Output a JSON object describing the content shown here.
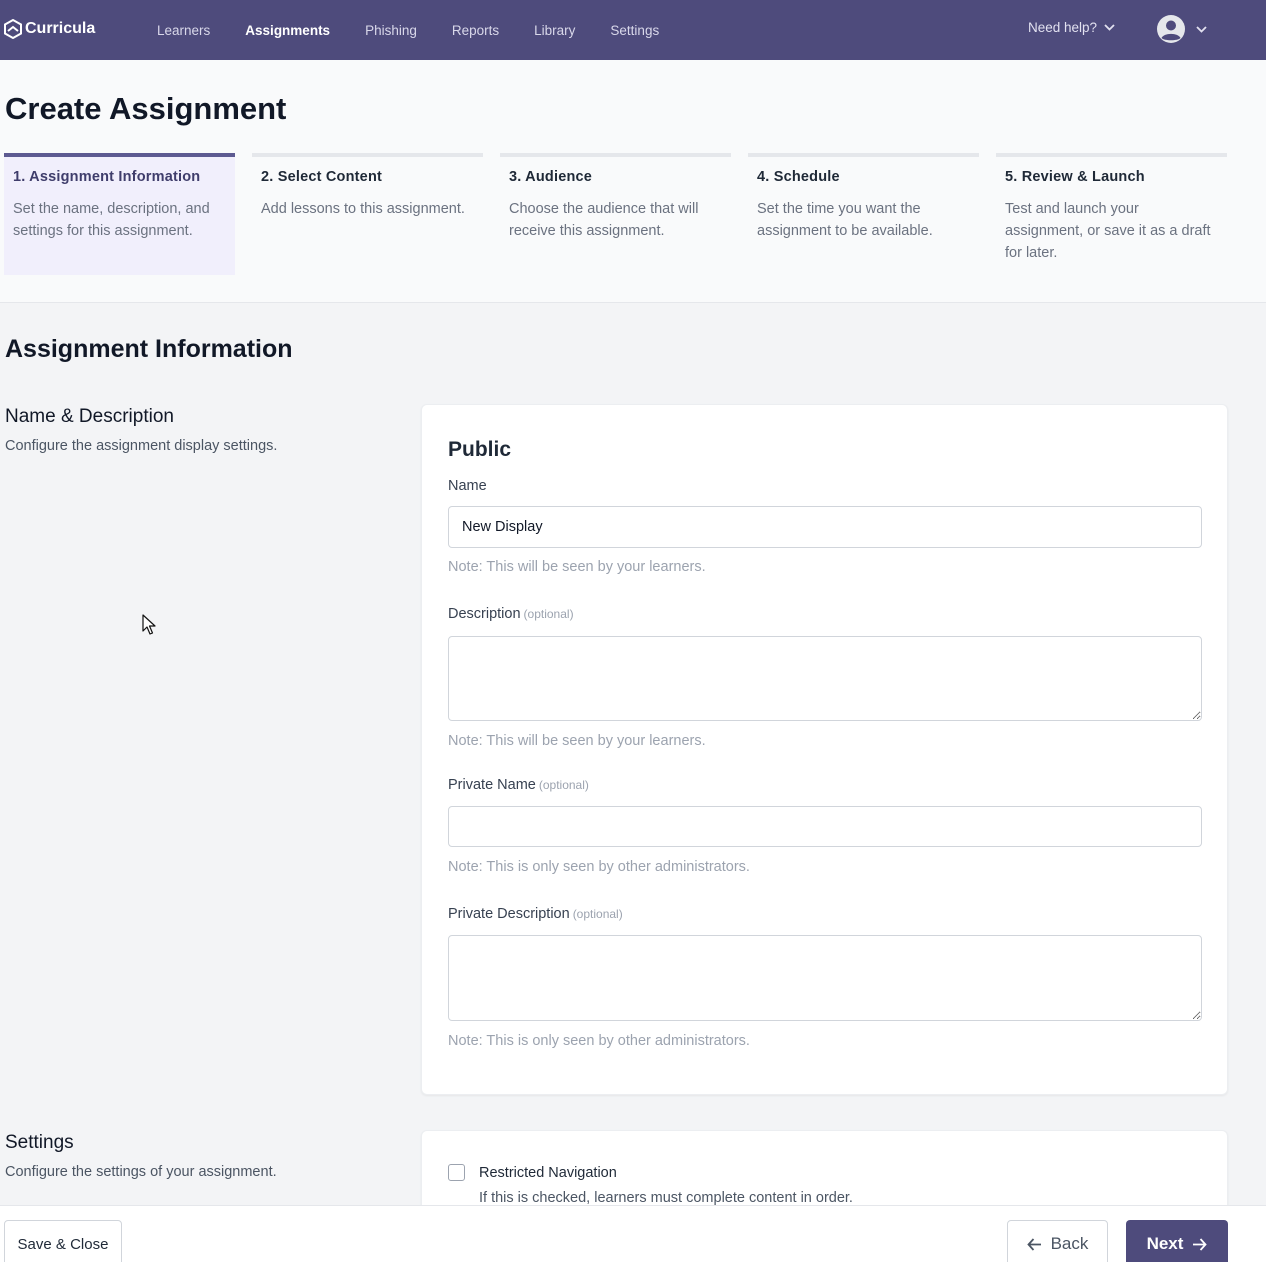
{
  "nav": {
    "brand": "Curricula",
    "links": [
      "Learners",
      "Assignments",
      "Phishing",
      "Reports",
      "Library",
      "Settings"
    ],
    "active": "Assignments",
    "help": "Need help?"
  },
  "page": {
    "title": "Create Assignment"
  },
  "steps": [
    {
      "title": "1. Assignment Information",
      "desc": "Set the name, description, and settings for this assignment."
    },
    {
      "title": "2. Select Content",
      "desc": "Add lessons to this assignment."
    },
    {
      "title": "3. Audience",
      "desc": "Choose the audience that will receive this assignment."
    },
    {
      "title": "4. Schedule",
      "desc": "Set the time you want the assignment to be available."
    },
    {
      "title": "5. Review & Launch",
      "desc": "Test and launch your assignment, or save it as a draft for later."
    }
  ],
  "section": {
    "heading": "Assignment Information",
    "name_desc": {
      "title": "Name & Description",
      "desc": "Configure the assignment display settings."
    },
    "settings": {
      "title": "Settings",
      "desc": "Configure the settings of your assignment."
    }
  },
  "form": {
    "card_title": "Public",
    "name": {
      "label": "Name",
      "value": "New Display",
      "note": "Note: This will be seen by your learners."
    },
    "description": {
      "label": "Description",
      "optional": "(optional)",
      "value": "",
      "note": "Note: This will be seen by your learners."
    },
    "private_name": {
      "label": "Private Name",
      "optional": "(optional)",
      "value": "",
      "note": "Note: This is only seen by other administrators."
    },
    "private_description": {
      "label": "Private Description",
      "optional": "(optional)",
      "value": "",
      "note": "Note: This is only seen by other administrators."
    }
  },
  "settings_card": {
    "restricted_label": "Restricted Navigation",
    "restricted_desc": "If this is checked, learners must complete content in order.",
    "restricted_checked": false
  },
  "footer": {
    "save_close": "Save & Close",
    "back": "Back",
    "next": "Next"
  },
  "colors": {
    "nav_bg": "#4e4b7c",
    "accent": "#5d5a91",
    "step_active_bg": "#f1effc"
  }
}
